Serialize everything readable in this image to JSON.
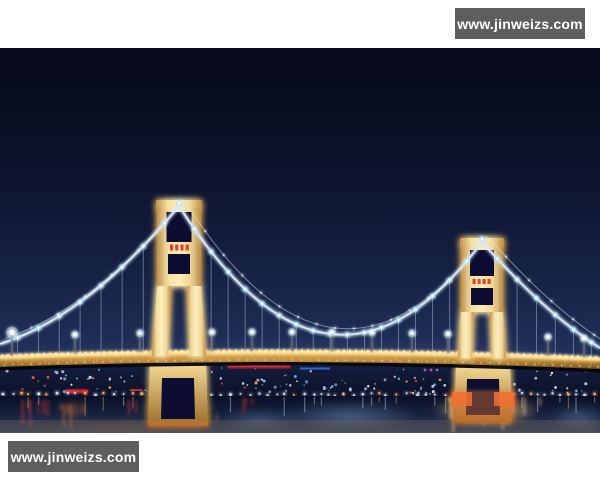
{
  "watermarks": {
    "text": "www.jinweizs.com",
    "badge_bg": "#5d5e5f",
    "text_color": "#ffffff"
  },
  "photo": {
    "description": "Night photograph of a twin-tower suspension bridge lit in golden light over a river; strings of white lights run along the main cables, city lights line the far shore and colorful red, gold and blue reflections shimmer in the water",
    "palette": {
      "sky_top": "#060a19",
      "sky_mid": "#0e1733",
      "sky_low": "#1d2b52",
      "sky_horizon": "#2b3b66",
      "opening_dark": "#0a1130",
      "tower_gold_hi": "#ffedb8",
      "tower_gold": "#f4df a0",
      "tower_gold_edge": "#c0914a",
      "tower_sign_red": "#d93322",
      "deck_strip": "#ffdd8f",
      "deck_dot": "#fff3c8",
      "deck_dot_dim": "#ffca70",
      "deck_girder_hi": "#e2b263",
      "deck_girder_mid": "#c08e3e",
      "deck_girder_dk": "#71501d",
      "deck_tick": "#e6b465",
      "under_deck_shadow": "#04060e",
      "cable": "#d9e8f6",
      "cable_light_core": "#eefcff",
      "cable_light_halo": "#8fd8ff",
      "lamp_core": "#ffffff",
      "lamp_halo": "#cfeaff",
      "pole_gray": "#6a7282",
      "city_band_hi": "#131d3e",
      "city_band_lo": "#0b1128",
      "city_white": "#d3dcf5",
      "city_warm": "#ffb066",
      "city_red": "#ff5246",
      "city_cyan": "#7fd0ff",
      "city_magenta": "#d06ae0",
      "neon_red": "#ff2f2f",
      "neon_blue": "#3d76ff",
      "water_top": "#0a0f26",
      "water_mid": "#16223f",
      "water_low": "#31415f",
      "reflect_gold": "#ffcf7c",
      "reflect_white": "#ffffff",
      "reflect_red": "#ff4534",
      "reflect_orange": "#ff8438",
      "reflect_blue": "#8fb9e6",
      "pier_gold_hi": "#f4d894",
      "pier_gold_dk": "#9a6c2a",
      "pier_orange": "#f07030",
      "warm_sheen": "#8a7152"
    }
  }
}
